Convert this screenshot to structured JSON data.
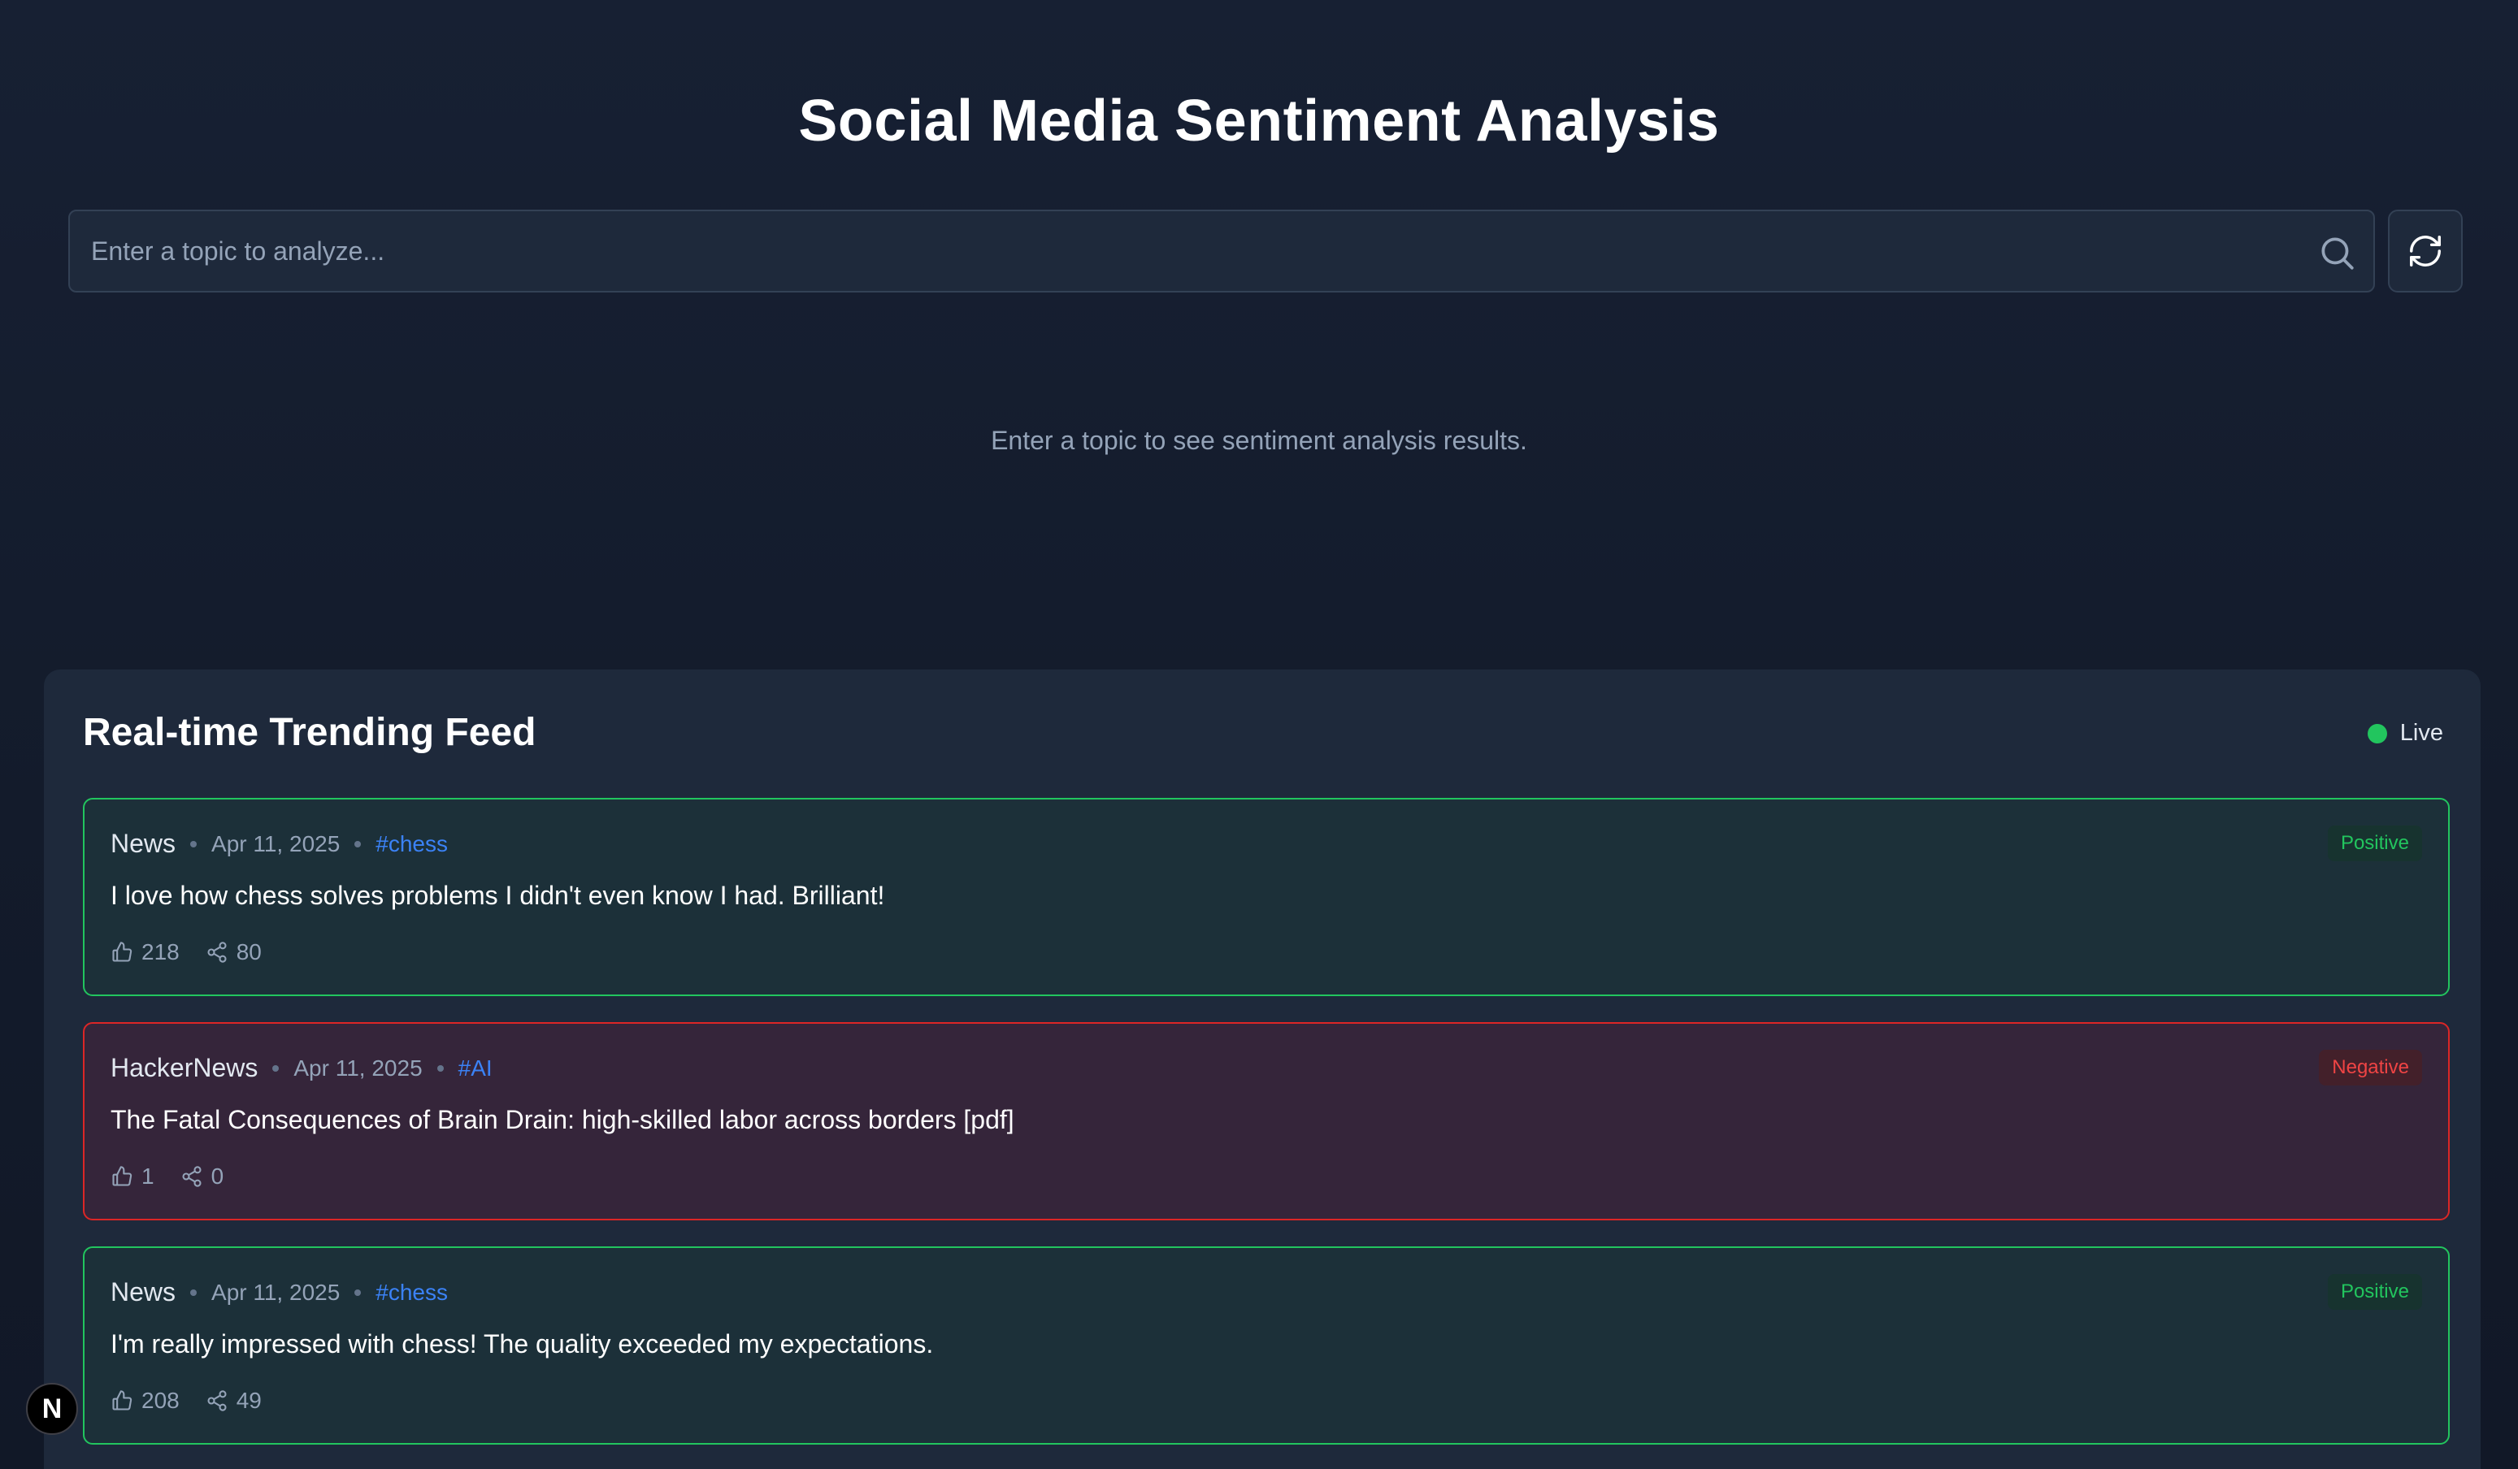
{
  "header": {
    "title": "Social Media Sentiment Analysis"
  },
  "search": {
    "placeholder": "Enter a topic to analyze...",
    "value": ""
  },
  "empty_state": {
    "message": "Enter a topic to see sentiment analysis results."
  },
  "feed": {
    "title": "Real-time Trending Feed",
    "status": "Live",
    "posts": [
      {
        "source": "News",
        "date": "Apr 11, 2025",
        "tag": "#chess",
        "sentiment": "Positive",
        "text": "I love how chess solves problems I didn't even know I had. Brilliant!",
        "likes": "218",
        "shares": "80"
      },
      {
        "source": "HackerNews",
        "date": "Apr 11, 2025",
        "tag": "#AI",
        "sentiment": "Negative",
        "text": "The Fatal Consequences of Brain Drain: high-skilled labor across borders [pdf]",
        "likes": "1",
        "shares": "0"
      },
      {
        "source": "News",
        "date": "Apr 11, 2025",
        "tag": "#chess",
        "sentiment": "Positive",
        "text": "I'm really impressed with chess! The quality exceeded my expectations.",
        "likes": "208",
        "shares": "49"
      }
    ]
  },
  "dev_badge": {
    "label": "N"
  },
  "colors": {
    "positive": "#22c55e",
    "negative": "#ef4444",
    "tag": "#3b82f6",
    "live": "#22c55e"
  }
}
